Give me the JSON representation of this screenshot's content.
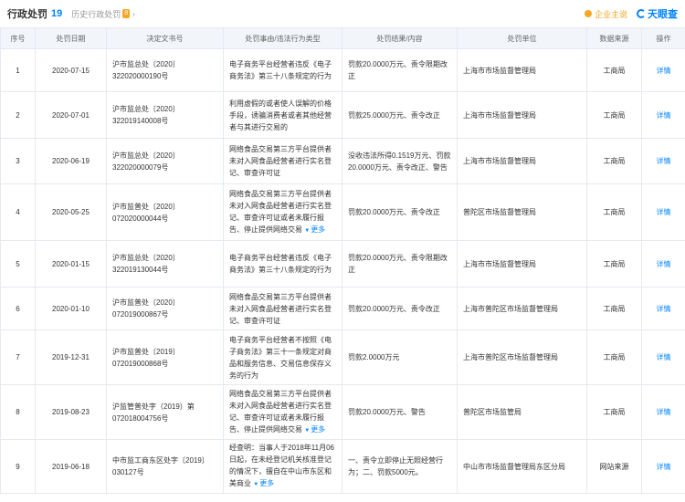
{
  "header": {
    "title": "行政处罚",
    "count": "19",
    "history_label": "历史行政处罚",
    "history_count": "8",
    "assistant_label": "企业主说",
    "logo_text": "天眼查"
  },
  "columns": [
    "序号",
    "处罚日期",
    "决定文书号",
    "处罚事由/违法行为类型",
    "处罚结果/内容",
    "处罚单位",
    "数据来源",
    "操作"
  ],
  "more_label": "更多",
  "rows": [
    {
      "no": "1",
      "date": "2020-07-15",
      "doc": "沪市监总处〔2020〕322020000190号",
      "reason": "电子商务平台经营者违反《电子商务法》第三十八条规定的行为",
      "more": false,
      "result": "罚款20.0000万元、责令限期改正",
      "unit": "上海市市场监督管理局",
      "source": "工商局",
      "action": "详情"
    },
    {
      "no": "2",
      "date": "2020-07-01",
      "doc": "沪市监总处〔2020〕322019140008号",
      "reason": "利用虚假的或者使人误解的价格手段，诱骗消费者或者其他经营者与其进行交易的",
      "more": false,
      "result": "罚款25.0000万元、责令改正",
      "unit": "上海市市场监督管理局",
      "source": "工商局",
      "action": "详情"
    },
    {
      "no": "3",
      "date": "2020-06-19",
      "doc": "沪市监总处〔2020〕322020000079号",
      "reason": "网络食品交易第三方平台提供者未对入网食品经营者进行实名登记、审查许可证",
      "more": false,
      "result": "没收违法所得0.1519万元、罚款20.0000万元、责令改正、警告",
      "unit": "上海市市场监督管理局",
      "source": "工商局",
      "action": "详情"
    },
    {
      "no": "4",
      "date": "2020-05-25",
      "doc": "沪市监普处〔2020〕072020000044号",
      "reason": "网络食品交易第三方平台提供者未对入网食品经营者进行实名登记、审查许可证或者未履行报告、停止提供网络交易",
      "more": true,
      "result": "罚款20.0000万元、责令改正",
      "unit": "普陀区市场监督管理局",
      "source": "工商局",
      "action": "详情"
    },
    {
      "no": "5",
      "date": "2020-01-15",
      "doc": "沪市监总处〔2020〕322019130044号",
      "reason": "电子商务平台经营者违反《电子商务法》第三十八条规定的行为",
      "more": false,
      "result": "罚款20.0000万元、责令限期改正",
      "unit": "上海市市场监督管理局",
      "source": "工商局",
      "action": "详情"
    },
    {
      "no": "6",
      "date": "2020-01-10",
      "doc": "沪市监普处〔2020〕072019000867号",
      "reason": "网络食品交易第三方平台提供者未对入网食品经营者进行实名登记、审查许可证",
      "more": false,
      "result": "罚款20.0000万元、责令改正",
      "unit": "上海市普陀区市场监督管理局",
      "source": "工商局",
      "action": "详情"
    },
    {
      "no": "7",
      "date": "2019-12-31",
      "doc": "沪市监普处〔2019〕072019000868号",
      "reason": "电子商务平台经营者不按照《电子商务法》第三十一条规定对商品和服务信息、交易信息保存义务的行为",
      "more": false,
      "result": "罚款2.0000万元",
      "unit": "上海市普陀区市场监督管理局",
      "source": "工商局",
      "action": "详情"
    },
    {
      "no": "8",
      "date": "2019-08-23",
      "doc": "沪监管普处字（2019）第072018004756号",
      "reason": "网络食品交易第三方平台提供者未对入网食品经营者进行实名登记、审查许可证或者未履行报告、停止提供网络交易",
      "more": true,
      "result": "罚款20.0000万元、警告",
      "unit": "普陀区市场监管局",
      "source": "工商局",
      "action": "详情"
    },
    {
      "no": "9",
      "date": "2019-06-18",
      "doc": "中市监工商东区处字〔2019〕030127号",
      "reason": "经查明：当事人于2018年11月06日起，在未经登记机关核准登记的情况下，擅自在中山市东区和美商业",
      "more": true,
      "result": "一、责令立即停止无照经营行为；二、罚款5000元。",
      "unit": "中山市市场监督管理局东区分局",
      "source": "网站来源",
      "action": "详情"
    }
  ],
  "colors": {
    "accent": "#0084ff",
    "header_bg": "#f2f5fa",
    "border": "#e6e9ef",
    "badge": "#f5a623"
  }
}
